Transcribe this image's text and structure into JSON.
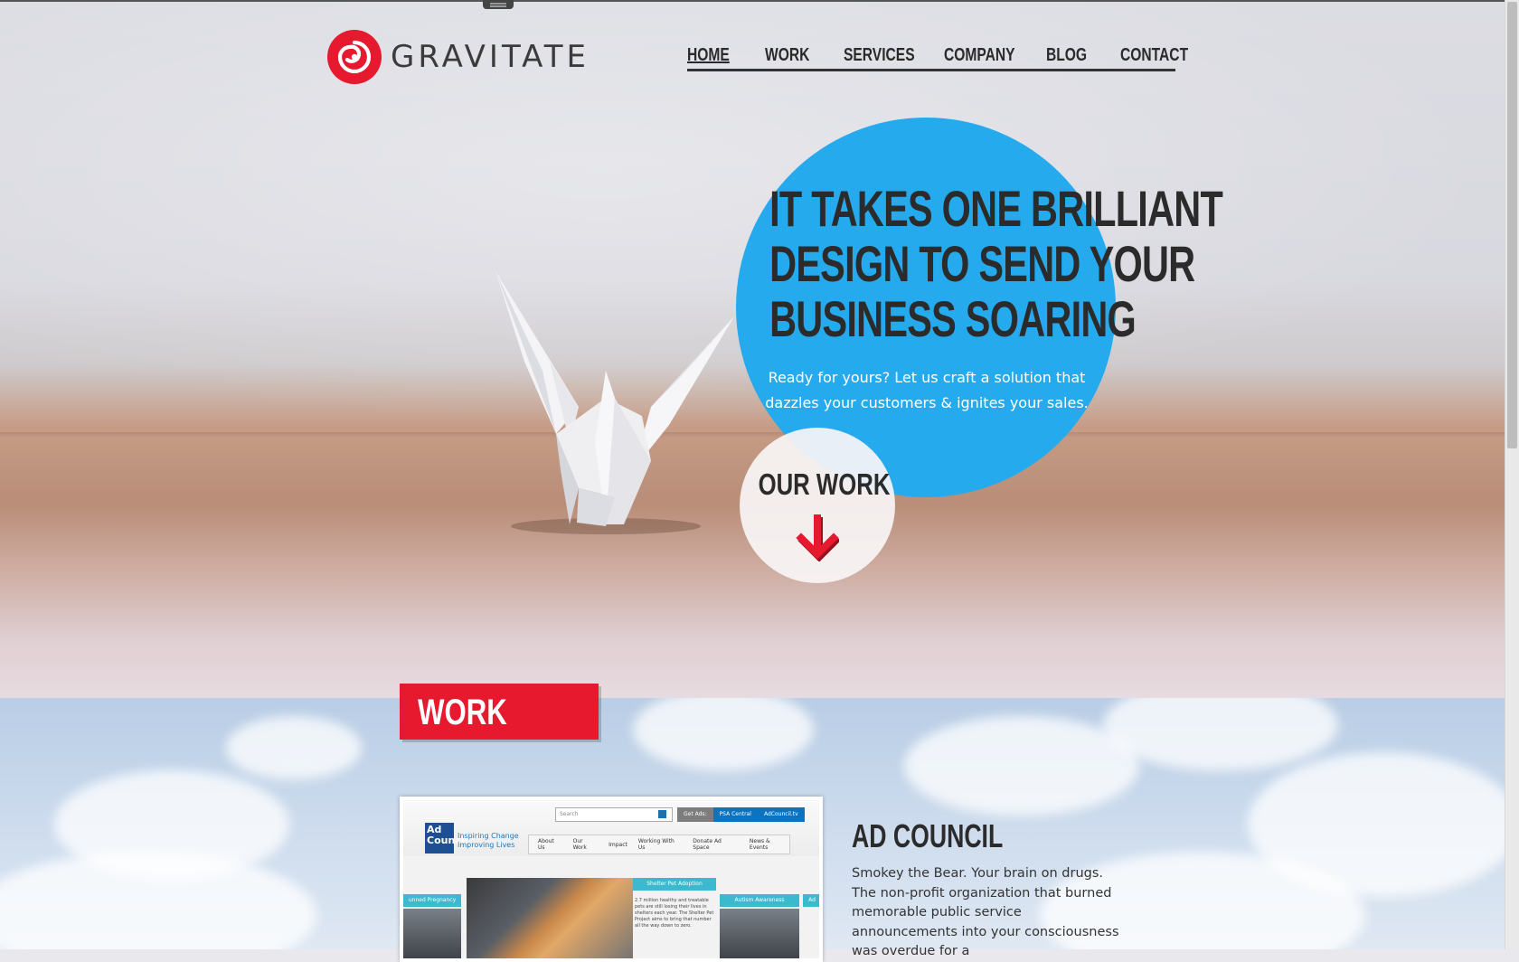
{
  "header": {
    "brand": "GRAVITATE",
    "nav": [
      "HOME",
      "WORK",
      "SERVICES",
      "COMPANY",
      "BLOG",
      "CONTACT"
    ]
  },
  "hero": {
    "headline_lines": [
      "IT TAKES ONE BRILLIANT",
      "DESIGN TO SEND YOUR",
      "BUSINESS SOARING"
    ],
    "subline": "Ready for yours? Let us craft a solution that dazzles your customers & ignites your sales.",
    "cta": "OUR WORK",
    "cta_icon": "arrow-down-icon"
  },
  "work": {
    "section_label": "WORK",
    "client": "AD COUNCIL",
    "description": "Smokey the Bear. Your brain on drugs. The non-profit organization that burned memorable public service announcements into your consciousness was overdue for a",
    "preview": {
      "search_placeholder": "Search",
      "buttons": [
        "Get Ads:",
        "PSA Central",
        "AdCouncil.tv"
      ],
      "logo": "Ad Council",
      "tagline": "Inspiring Change Improving Lives",
      "menu": [
        "About Us",
        "Our Work",
        "Impact",
        "Working With Us",
        "Donate Ad Space",
        "News & Events"
      ],
      "panel_labels": [
        "unned Pregnancy",
        "Shelter Pet Adoption",
        "Autism Awareness",
        "Ad"
      ],
      "panel_text": "2.7 million healthy and treatable pets are still losing their lives in shelters each year. The Shelter Pet Project aims to bring that number all the way down to zero."
    }
  },
  "colors": {
    "brand_red": "#e6192f",
    "hero_blue": "#25aaed",
    "text_dark": "#2b2b2b"
  }
}
